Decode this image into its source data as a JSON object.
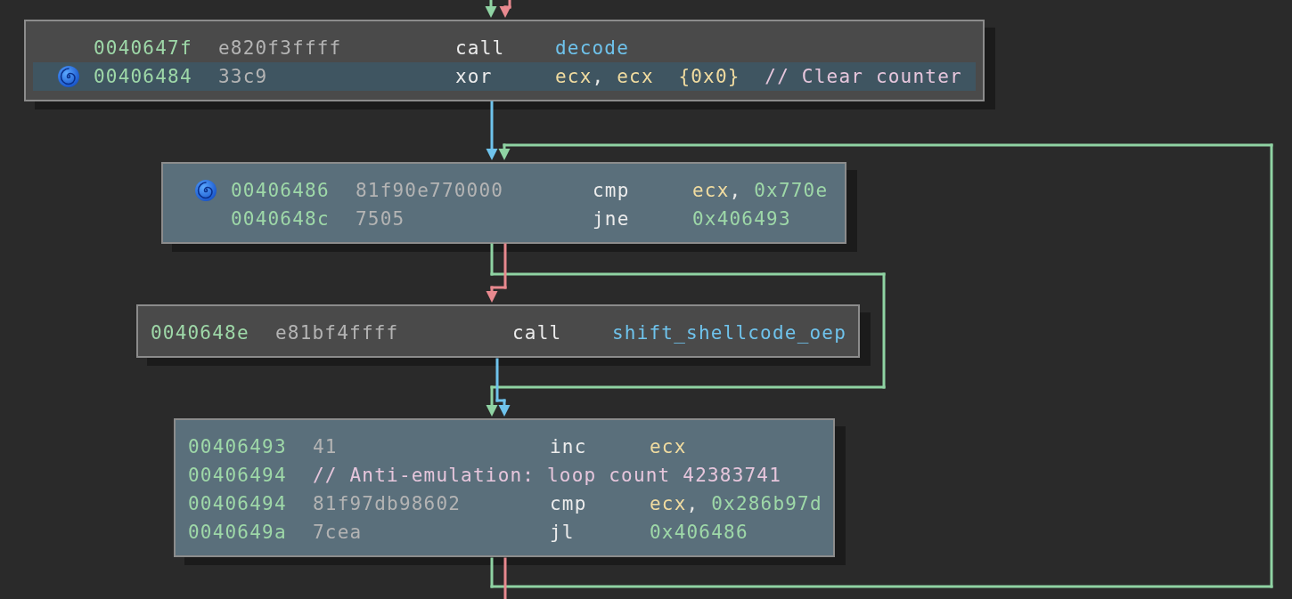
{
  "blocks": [
    {
      "highlighted": false,
      "rows": [
        {
          "kind": "instruction",
          "tagged": false,
          "highlighted": false,
          "address": "0040647f",
          "bytes": "e820f3ffff",
          "mnemonic": "call",
          "operands": [
            {
              "kind": "symbol",
              "text": "decode"
            }
          ]
        },
        {
          "kind": "instruction",
          "tagged": true,
          "highlighted": true,
          "address": "00406484",
          "bytes": "33c9",
          "mnemonic": "xor",
          "operands": [
            {
              "kind": "register",
              "text": "ecx"
            },
            {
              "kind": "punctuation",
              "text": ","
            },
            {
              "kind": "register",
              "text": "ecx"
            },
            {
              "kind": "annotation",
              "text": "{0x0}"
            },
            {
              "kind": "comment",
              "text": "// Clear counter"
            }
          ]
        }
      ]
    },
    {
      "highlighted": true,
      "rows": [
        {
          "kind": "instruction",
          "tagged": true,
          "highlighted": false,
          "address": "00406486",
          "bytes": "81f90e770000",
          "mnemonic": "cmp",
          "operands": [
            {
              "kind": "register",
              "text": "ecx"
            },
            {
              "kind": "punctuation",
              "text": ","
            },
            {
              "kind": "number",
              "text": "0x770e"
            }
          ]
        },
        {
          "kind": "instruction",
          "tagged": false,
          "highlighted": false,
          "address": "0040648c",
          "bytes": "7505",
          "mnemonic": "jne",
          "operands": [
            {
              "kind": "number",
              "text": "0x406493"
            }
          ]
        }
      ]
    },
    {
      "highlighted": false,
      "rows": [
        {
          "kind": "instruction",
          "tagged": false,
          "highlighted": false,
          "address": "0040648e",
          "bytes": "e81bf4ffff",
          "mnemonic": "call",
          "operands": [
            {
              "kind": "symbol",
              "text": "shift_shellcode_oep"
            }
          ]
        }
      ]
    },
    {
      "highlighted": true,
      "rows": [
        {
          "kind": "instruction",
          "tagged": false,
          "highlighted": false,
          "address": "00406493",
          "bytes": "41",
          "mnemonic": "inc",
          "operands": [
            {
              "kind": "register",
              "text": "ecx"
            }
          ]
        },
        {
          "kind": "comment",
          "tagged": false,
          "highlighted": false,
          "address": "00406494",
          "text": "// Anti-emulation: loop count 42383741"
        },
        {
          "kind": "instruction",
          "tagged": false,
          "highlighted": false,
          "address": "00406494",
          "bytes": "81f97db98602",
          "mnemonic": "cmp",
          "operands": [
            {
              "kind": "register",
              "text": "ecx"
            },
            {
              "kind": "punctuation",
              "text": ","
            },
            {
              "kind": "number",
              "text": "0x286b97d"
            }
          ]
        },
        {
          "kind": "instruction",
          "tagged": false,
          "highlighted": false,
          "address": "0040649a",
          "bytes": "7cea",
          "mnemonic": "jl",
          "operands": [
            {
              "kind": "number",
              "text": "0x406486"
            }
          ]
        }
      ]
    }
  ],
  "edges": [
    {
      "kind": "true"
    },
    {
      "kind": "false"
    },
    {
      "kind": "unconditional"
    },
    {
      "kind": "true"
    },
    {
      "kind": "true"
    },
    {
      "kind": "false"
    },
    {
      "kind": "unconditional"
    },
    {
      "kind": "false"
    }
  ]
}
